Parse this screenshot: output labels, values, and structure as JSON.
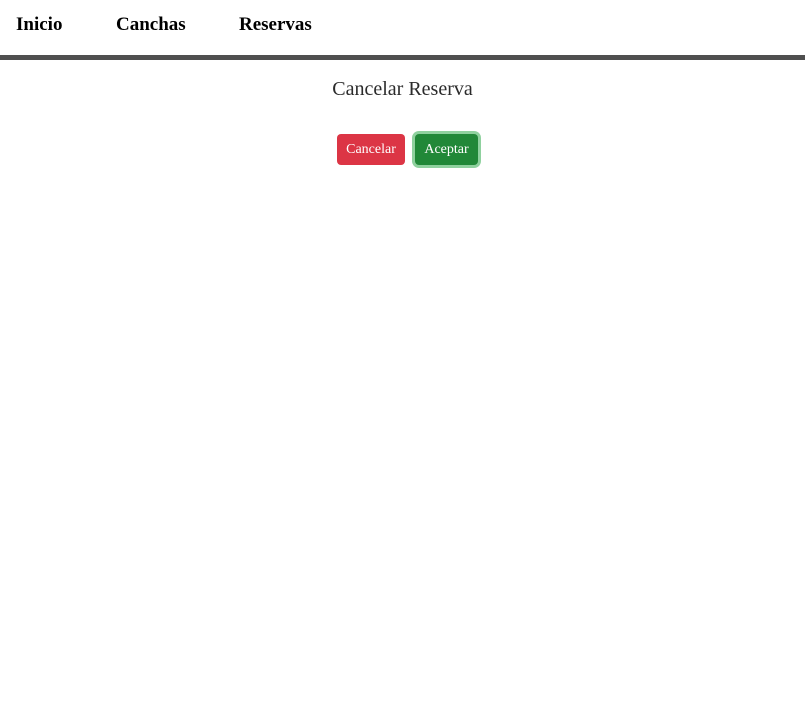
{
  "nav": {
    "items": [
      {
        "label": "Inicio"
      },
      {
        "label": "Canchas"
      },
      {
        "label": "Reservas"
      }
    ]
  },
  "page": {
    "title": "Cancelar Reserva"
  },
  "actions": {
    "cancel_label": "Cancelar",
    "accept_label": "Aceptar"
  },
  "colors": {
    "cancel_button": "#dc3545",
    "accept_button": "#218838",
    "accept_focus_ring": "#8fd19e",
    "nav_divider": "#4f4f4f"
  }
}
